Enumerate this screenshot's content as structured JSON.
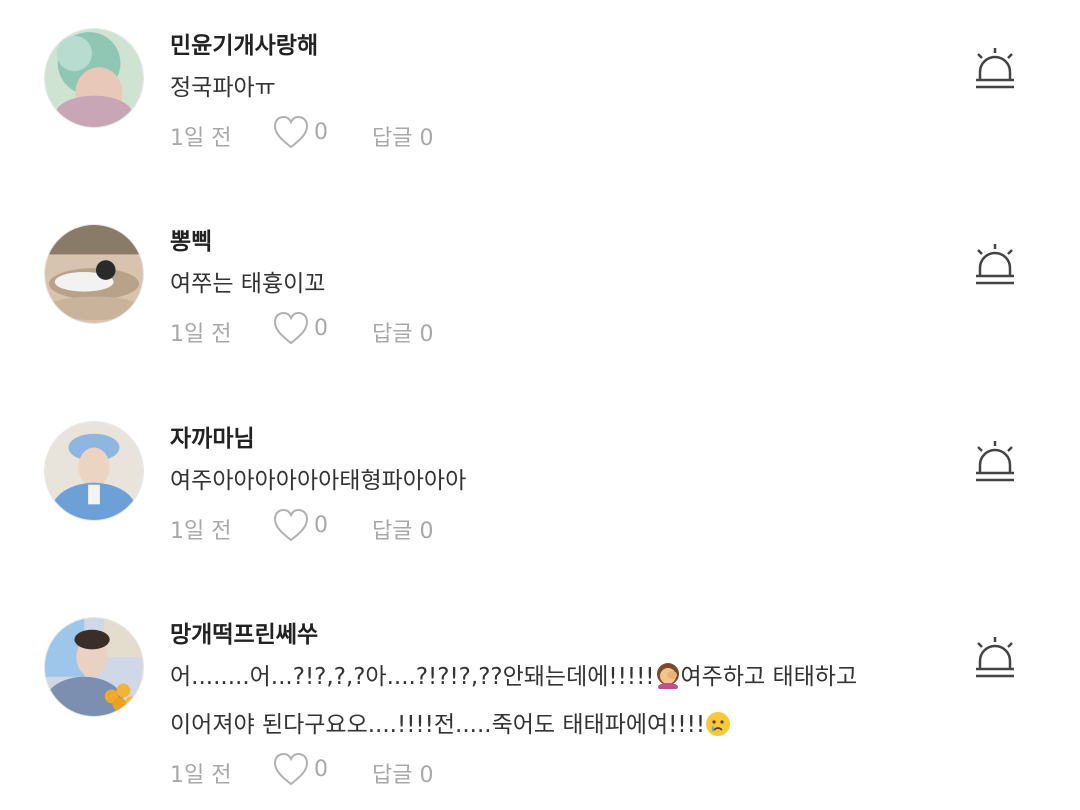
{
  "comments": [
    {
      "username": "민윤기개사랑해",
      "lines": [
        "정국파아ㅠ"
      ],
      "time": "1일 전",
      "likes": "0",
      "reply_label": "답글 0"
    },
    {
      "username": "뽕삑",
      "lines": [
        "여쭈는 태흉이꼬"
      ],
      "time": "1일 전",
      "likes": "0",
      "reply_label": "답글 0"
    },
    {
      "username": "자까마님",
      "lines": [
        "여주아아아아아아태형파아아아"
      ],
      "time": "1일 전",
      "likes": "0",
      "reply_label": "답글 0"
    },
    {
      "username": "망개떡프린쎄쑤",
      "lines": [
        "어........어...?!?,?,?아....?!?!?,??안돼는데에!!!!!",
        "여주하고 태태하고",
        "이어져야 된다구요오....!!!!전.....죽어도 태태파에여!!!!"
      ],
      "time": "1일 전",
      "likes": "0",
      "reply_label": "답글 0"
    }
  ],
  "colors": {
    "text": "#222222",
    "meta": "#a8a8a8",
    "icon": "#444444"
  },
  "icons": {
    "like": "heart-outline-icon",
    "report": "siren-icon",
    "emoji_1": "facepalm-emoji",
    "emoji_2": "crying-face-emoji"
  }
}
